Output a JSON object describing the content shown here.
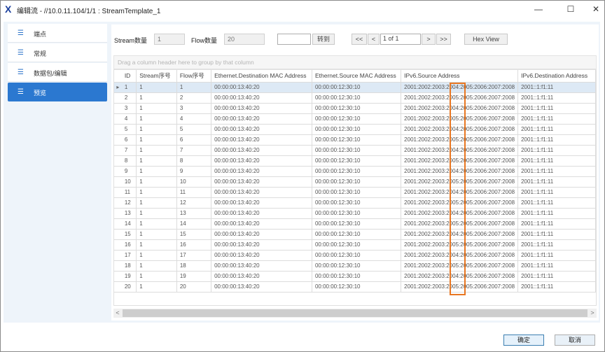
{
  "window": {
    "title": "编辑流 - //10.0.11.104/1/1 : StreamTemplate_1",
    "logo_icon": "app-logo-x",
    "controls": {
      "minimize": "—",
      "maximize": "☐",
      "close": "✕"
    }
  },
  "sidebar": {
    "items": [
      {
        "label": "端点",
        "icon": "list-icon",
        "active": false
      },
      {
        "label": "常规",
        "icon": "list-icon",
        "active": false
      },
      {
        "label": "数据包/编辑",
        "icon": "list-icon",
        "active": false
      },
      {
        "label": "预览",
        "icon": "list-icon",
        "active": true
      }
    ]
  },
  "toolbar": {
    "stream_count_label": "Stream数量",
    "stream_count_value": "1",
    "flow_count_label": "Flow数量",
    "flow_count_value": "20",
    "goto_input_value": "",
    "goto_button": "转到",
    "first_button": "<<",
    "prev_button": "<",
    "page_value": "1 of 1",
    "next_button": ">",
    "last_button": ">>",
    "hex_view_button": "Hex View"
  },
  "grid": {
    "group_panel_text": "Drag a column header here to group by that column",
    "columns": [
      "ID",
      "Stream序号",
      "Flow序号",
      "Ethernet.Destination MAC Address",
      "Ethernet.Source MAC Address",
      "IPv6.Source Address",
      "IPv6.Destination Address"
    ],
    "rows": [
      [
        "1",
        "1",
        "1",
        "00:00:00:13:40:20",
        "00:00:00:12:30:10",
        "2001:2002:2003:2004:2005:2006:2007:2008",
        "2001::1:f1:11"
      ],
      [
        "2",
        "1",
        "2",
        "00:00:00:13:40:20",
        "00:00:00:12:30:10",
        "2001:2002:2003:2005:2005:2006:2007:2008",
        "2001::1:f1:11"
      ],
      [
        "3",
        "1",
        "3",
        "00:00:00:13:40:20",
        "00:00:00:12:30:10",
        "2001:2002:2003:2004:2005:2006:2007:2008",
        "2001::1:f1:11"
      ],
      [
        "4",
        "1",
        "4",
        "00:00:00:13:40:20",
        "00:00:00:12:30:10",
        "2001:2002:2003:2005:2005:2006:2007:2008",
        "2001::1:f1:11"
      ],
      [
        "5",
        "1",
        "5",
        "00:00:00:13:40:20",
        "00:00:00:12:30:10",
        "2001:2002:2003:2004:2005:2006:2007:2008",
        "2001::1:f1:11"
      ],
      [
        "6",
        "1",
        "6",
        "00:00:00:13:40:20",
        "00:00:00:12:30:10",
        "2001:2002:2003:2005:2005:2006:2007:2008",
        "2001::1:f1:11"
      ],
      [
        "7",
        "1",
        "7",
        "00:00:00:13:40:20",
        "00:00:00:12:30:10",
        "2001:2002:2003:2004:2005:2006:2007:2008",
        "2001::1:f1:11"
      ],
      [
        "8",
        "1",
        "8",
        "00:00:00:13:40:20",
        "00:00:00:12:30:10",
        "2001:2002:2003:2005:2005:2006:2007:2008",
        "2001::1:f1:11"
      ],
      [
        "9",
        "1",
        "9",
        "00:00:00:13:40:20",
        "00:00:00:12:30:10",
        "2001:2002:2003:2004:2005:2006:2007:2008",
        "2001::1:f1:11"
      ],
      [
        "10",
        "1",
        "10",
        "00:00:00:13:40:20",
        "00:00:00:12:30:10",
        "2001:2002:2003:2005:2005:2006:2007:2008",
        "2001::1:f1:11"
      ],
      [
        "11",
        "1",
        "11",
        "00:00:00:13:40:20",
        "00:00:00:12:30:10",
        "2001:2002:2003:2004:2005:2006:2007:2008",
        "2001::1:f1:11"
      ],
      [
        "12",
        "1",
        "12",
        "00:00:00:13:40:20",
        "00:00:00:12:30:10",
        "2001:2002:2003:2005:2005:2006:2007:2008",
        "2001::1:f1:11"
      ],
      [
        "13",
        "1",
        "13",
        "00:00:00:13:40:20",
        "00:00:00:12:30:10",
        "2001:2002:2003:2004:2005:2006:2007:2008",
        "2001::1:f1:11"
      ],
      [
        "14",
        "1",
        "14",
        "00:00:00:13:40:20",
        "00:00:00:12:30:10",
        "2001:2002:2003:2005:2005:2006:2007:2008",
        "2001::1:f1:11"
      ],
      [
        "15",
        "1",
        "15",
        "00:00:00:13:40:20",
        "00:00:00:12:30:10",
        "2001:2002:2003:2004:2005:2006:2007:2008",
        "2001::1:f1:11"
      ],
      [
        "16",
        "1",
        "16",
        "00:00:00:13:40:20",
        "00:00:00:12:30:10",
        "2001:2002:2003:2005:2005:2006:2007:2008",
        "2001::1:f1:11"
      ],
      [
        "17",
        "1",
        "17",
        "00:00:00:13:40:20",
        "00:00:00:12:30:10",
        "2001:2002:2003:2004:2005:2006:2007:2008",
        "2001::1:f1:11"
      ],
      [
        "18",
        "1",
        "18",
        "00:00:00:13:40:20",
        "00:00:00:12:30:10",
        "2001:2002:2003:2005:2005:2006:2007:2008",
        "2001::1:f1:11"
      ],
      [
        "19",
        "1",
        "19",
        "00:00:00:13:40:20",
        "00:00:00:12:30:10",
        "2001:2002:2003:2004:2005:2006:2007:2008",
        "2001::1:f1:11"
      ],
      [
        "20",
        "1",
        "20",
        "00:00:00:13:40:20",
        "00:00:00:12:30:10",
        "2001:2002:2003:2005:2005:2006:2007:2008",
        "2001::1:f1:11"
      ]
    ],
    "selected_row_index": 0,
    "row_indicator": "▸",
    "highlight_color": "#e87722"
  },
  "scrollbar": {
    "left_arrow": "<",
    "right_arrow": ">"
  },
  "footer": {
    "ok_button": "确定",
    "cancel_button": "取消"
  }
}
